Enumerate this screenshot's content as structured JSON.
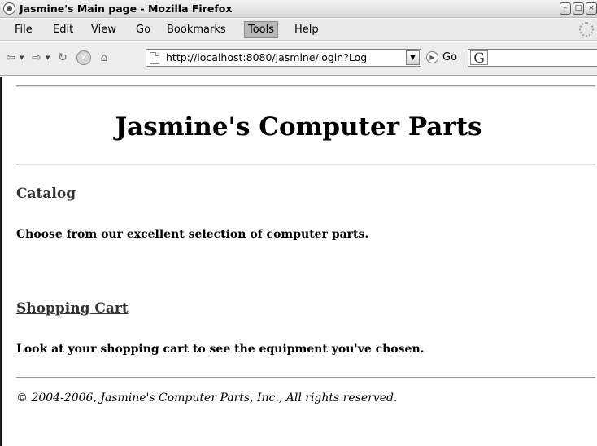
{
  "window": {
    "title": "Jasmine's Main page - Mozilla Firefox",
    "minimize": "–",
    "maximize": "□",
    "close": "×"
  },
  "menu": {
    "items": [
      {
        "label": "File"
      },
      {
        "label": "Edit"
      },
      {
        "label": "View"
      },
      {
        "label": "Go"
      },
      {
        "label": "Bookmarks"
      },
      {
        "label": "Tools"
      },
      {
        "label": "Help"
      }
    ],
    "active": "Tools"
  },
  "toolbar": {
    "url": "http://localhost:8080/jasmine/login?Log",
    "go_label": "Go",
    "search_engine_glyph": "G"
  },
  "page": {
    "title": "Jasmine's Computer Parts",
    "catalog_link": "Catalog",
    "catalog_desc": "Choose from our excellent selection of computer parts.",
    "cart_link": "Shopping Cart",
    "cart_desc": "Look at your shopping cart to see the equipment you've chosen.",
    "footer": "© 2004-2006, Jasmine's Computer Parts, Inc., All rights reserved."
  },
  "icons": {
    "app": "firefox-icon",
    "back": "back-arrow-icon",
    "forward": "forward-arrow-icon",
    "reload": "reload-icon",
    "stop": "stop-icon",
    "home": "home-icon",
    "page": "page-icon",
    "go": "go-icon",
    "throbber": "throbber-icon"
  }
}
